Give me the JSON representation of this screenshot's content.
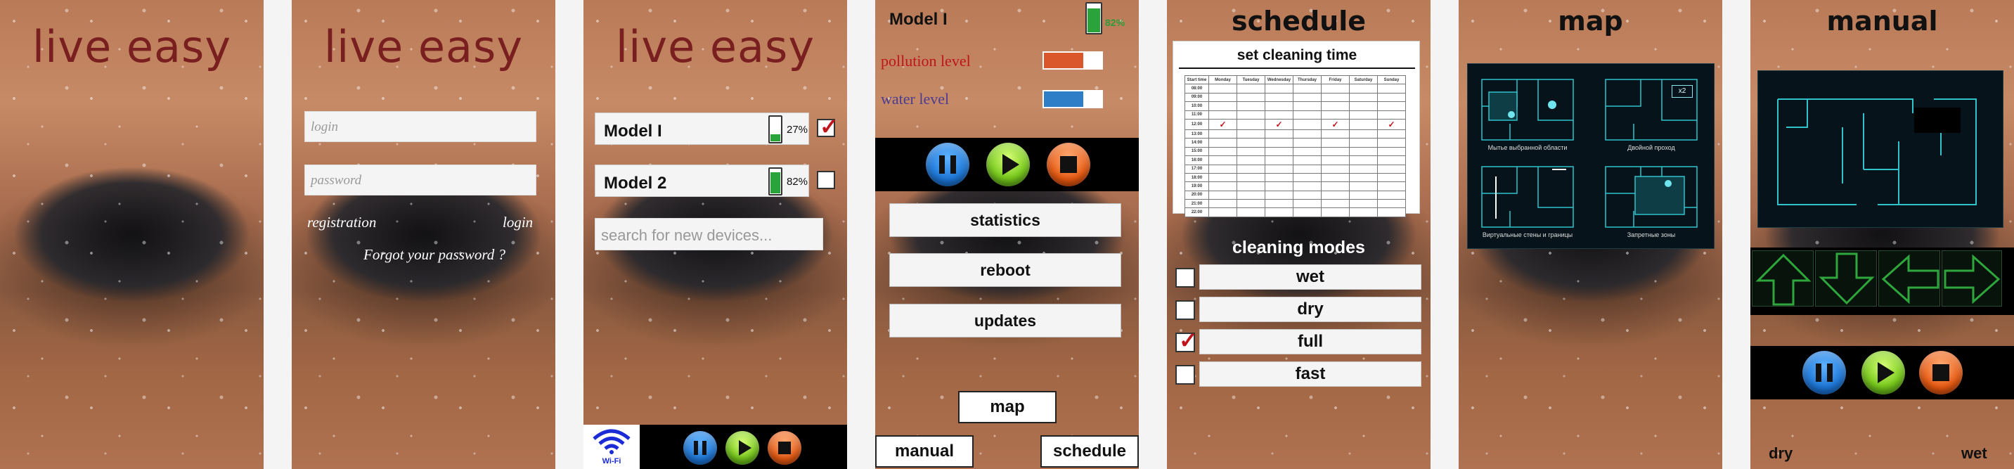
{
  "screen1": {
    "brand": "live easy"
  },
  "screen2": {
    "brand": "live easy",
    "login_placeholder": "login",
    "password_placeholder": "password",
    "registration": "registration",
    "login": "login",
    "forgot": "Forgot your password ?"
  },
  "screen3": {
    "brand": "live easy",
    "devices": [
      {
        "name": "Model I",
        "battery": "27%",
        "level": 0.27,
        "checked": true
      },
      {
        "name": "Model 2",
        "battery": "82%",
        "level": 0.82,
        "checked": false
      }
    ],
    "search_placeholder": "search for new devices...",
    "wifi_label": "Wi-Fi",
    "icons": {
      "wifi": "wifi-icon",
      "pause": "pause-icon",
      "play": "play-icon",
      "stop": "stop-icon"
    }
  },
  "screen4": {
    "model": "Model I",
    "battery_label": "82%",
    "battery_level": 0.82,
    "pollution_label": "pollution level",
    "water_label": "water level",
    "pollution_color": "#d9572a",
    "water_color": "#2d7ec7",
    "menu": [
      "statistics",
      "reboot",
      "updates"
    ],
    "nav": {
      "map": "map",
      "manual": "manual",
      "schedule": "schedule"
    }
  },
  "screen5": {
    "title": "schedule",
    "subtitle": "set cleaning time",
    "table": {
      "headers": [
        "Start time",
        "Monday",
        "Tuesday",
        "Wednesday",
        "Thursday",
        "Friday",
        "Saturday",
        "Sunday"
      ],
      "times": [
        "08:00",
        "09:00",
        "10:00",
        "11:00",
        "12:00",
        "13:00",
        "14:00",
        "15:00",
        "16:00",
        "17:00",
        "18:00",
        "19:00",
        "20:00",
        "21:00",
        "22:00"
      ],
      "checked": [
        {
          "time": "12:00",
          "day": "Monday"
        },
        {
          "time": "12:00",
          "day": "Wednesday"
        },
        {
          "time": "12:00",
          "day": "Friday"
        },
        {
          "time": "12:00",
          "day": "Sunday"
        }
      ]
    },
    "modes_title": "cleaning modes",
    "modes": [
      {
        "label": "wet",
        "checked": false
      },
      {
        "label": "dry",
        "checked": false
      },
      {
        "label": "full",
        "checked": true
      },
      {
        "label": "fast",
        "checked": false
      }
    ]
  },
  "screen6": {
    "title": "map",
    "maps": [
      {
        "caption": "Мытье выбранной области"
      },
      {
        "caption": "Двойной проход",
        "badge": "x2"
      },
      {
        "caption": "Виртуальные стены и границы"
      },
      {
        "caption": "Запретные зоны"
      }
    ]
  },
  "screen7": {
    "title": "manual",
    "arrows": [
      "arrow-up-icon",
      "arrow-down-icon",
      "arrow-left-icon",
      "arrow-right-icon"
    ],
    "dry": "dry",
    "wet": "wet"
  }
}
